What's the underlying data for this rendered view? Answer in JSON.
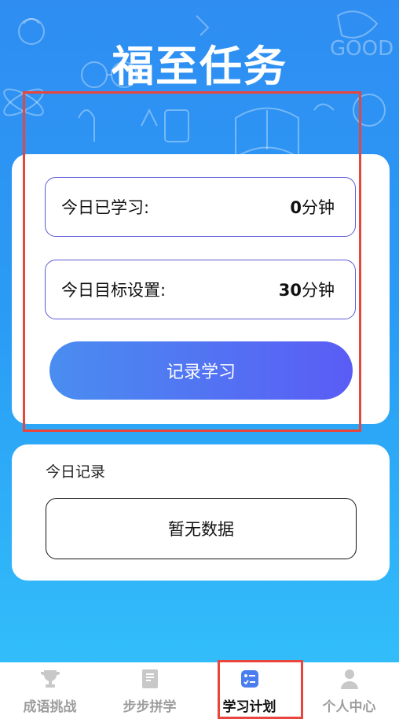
{
  "header": {
    "title": "福至任务"
  },
  "study_card": {
    "today_studied": {
      "label": "今日已学习:",
      "value": "0",
      "unit": "分钟"
    },
    "today_goal": {
      "label": "今日目标设置:",
      "value": "30",
      "unit": "分钟"
    },
    "record_button": "记录学习"
  },
  "records_card": {
    "title": "今日记录",
    "empty_text": "暂无数据"
  },
  "tabbar": {
    "items": [
      {
        "label": "成语挑战",
        "icon": "trophy-icon",
        "active": false
      },
      {
        "label": "步步拼学",
        "icon": "book-icon",
        "active": false
      },
      {
        "label": "学习计划",
        "icon": "plan-list-icon",
        "active": true
      },
      {
        "label": "个人中心",
        "icon": "person-icon",
        "active": false
      }
    ]
  },
  "colors": {
    "background_top": "#2f8df2",
    "background_bottom": "#33c3fb",
    "button_start": "#4a8df0",
    "button_end": "#5a5cf5",
    "row_border": "#5b5bd6",
    "highlight_box": "#e8453c",
    "active_icon": "#4a7df0"
  }
}
